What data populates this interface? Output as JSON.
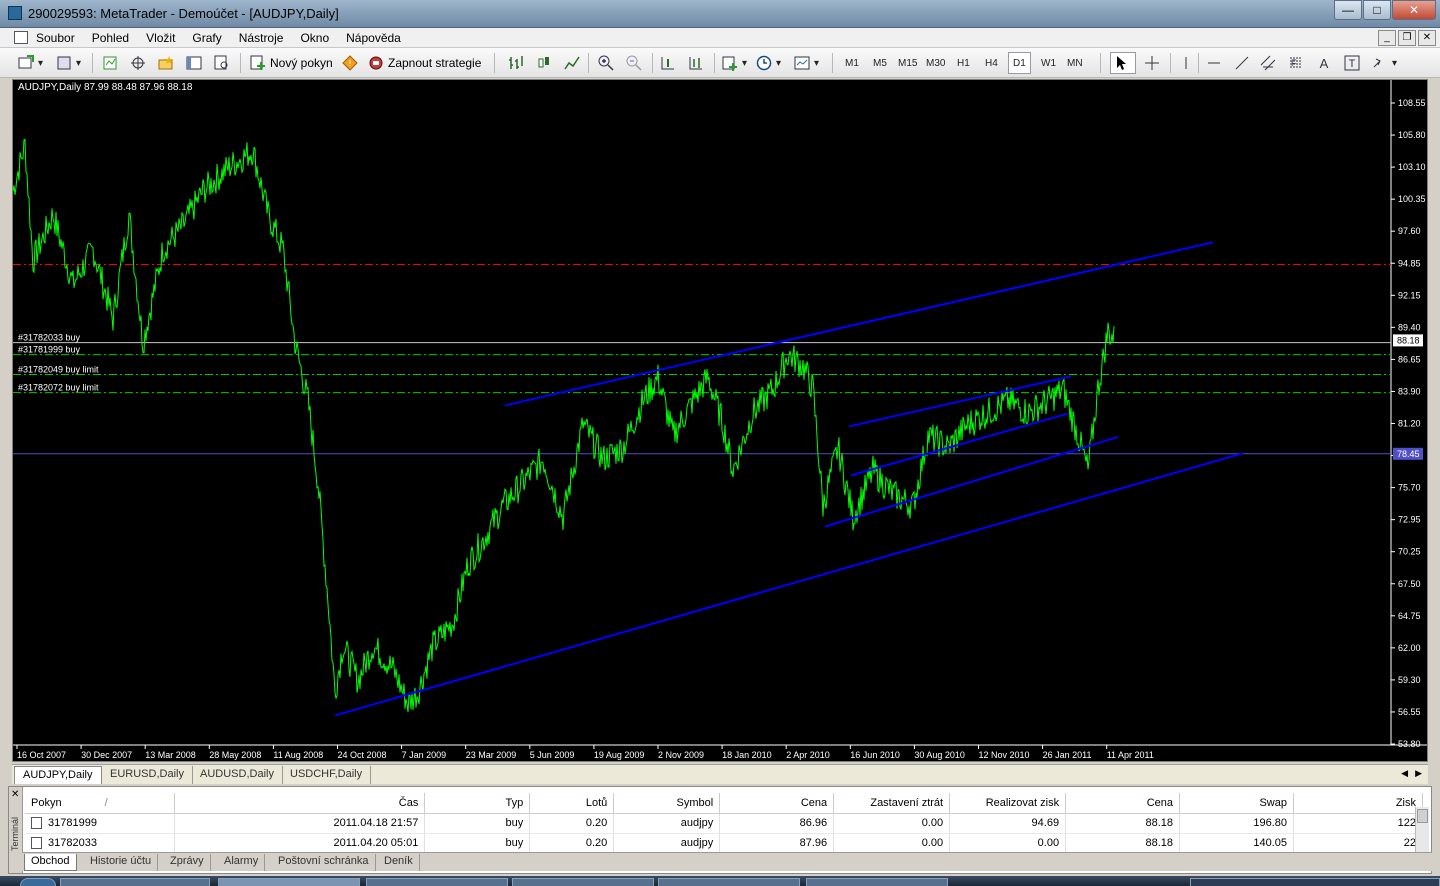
{
  "window": {
    "title": "290029593: MetaTrader - Demoúčet - [AUDJPY,Daily]"
  },
  "menu": [
    "Soubor",
    "Pohled",
    "Vložit",
    "Grafy",
    "Nástroje",
    "Okno",
    "Nápověda"
  ],
  "toolbar": {
    "new_order": "Nový pokyn",
    "auto_trading": "Zapnout strategie",
    "timeframes": [
      "M1",
      "M5",
      "M15",
      "M30",
      "H1",
      "H4",
      "D1",
      "W1",
      "MN"
    ],
    "active_timeframe": "D1"
  },
  "chart": {
    "header": "AUDJPY,Daily  87.99 88.48 87.96 88.18",
    "price_ticks": [
      "108.55",
      "105.80",
      "103.10",
      "100.35",
      "97.60",
      "94.85",
      "92.15",
      "89.40",
      "86.65",
      "83.90",
      "81.20",
      "78.45",
      "75.70",
      "72.95",
      "70.25",
      "67.50",
      "64.75",
      "62.00",
      "59.30",
      "56.55",
      "53.80"
    ],
    "date_ticks": [
      "16 Oct 2007",
      "30 Dec 2007",
      "13 Mar 2008",
      "28 May 2008",
      "11 Aug 2008",
      "24 Oct 2008",
      "7 Jan 2009",
      "23 Mar 2009",
      "5 Jun 2009",
      "19 Aug 2009",
      "2 Nov 2009",
      "18 Jan 2010",
      "2 Apr 2010",
      "16 Jun 2010",
      "30 Aug 2010",
      "12 Nov 2010",
      "26 Jan 2011",
      "11 Apr 2011"
    ],
    "current_price": "88.18",
    "hline_price": "78.45",
    "order_lines": [
      {
        "label": "#31782033 buy",
        "price": 87.99
      },
      {
        "label": "#31781999 buy",
        "price": 86.96
      },
      {
        "label": "#31782049 buy limit",
        "price": 85.25
      },
      {
        "label": "#31782072 buy limit",
        "price": 83.7
      }
    ],
    "stop_line_price": 94.69,
    "colors": {
      "price": "#00ff00",
      "trend": "#0000ff",
      "order": "#00cc00",
      "stop": "#ff0000",
      "hline": "#5050c8"
    }
  },
  "chart_tabs": [
    "AUDJPY,Daily",
    "EURUSD,Daily",
    "AUDUSD,Daily",
    "USDCHF,Daily"
  ],
  "orders": {
    "columns": [
      "Pokyn",
      "Čas",
      "Typ",
      "Lotů",
      "Symbol",
      "Cena",
      "Zastavení ztrát",
      "Realizovat zisk",
      "Cena",
      "Swap",
      "Zisk"
    ],
    "sort_marker": "/",
    "rows": [
      [
        "31781999",
        "2011.04.18 21:57",
        "buy",
        "0.20",
        "audjpy",
        "86.96",
        "0.00",
        "94.69",
        "88.18",
        "196.80",
        "122"
      ],
      [
        "31782033",
        "2011.04.20 05:01",
        "buy",
        "0.20",
        "audjpy",
        "87.96",
        "0.00",
        "0.00",
        "88.18",
        "140.05",
        "22"
      ]
    ]
  },
  "terminal": {
    "side_label": "Terminál",
    "tabs": [
      "Obchod",
      "Historie účtu",
      "Zprávy",
      "Alarmy",
      "Poštovní schránka",
      "Deník"
    ]
  }
}
